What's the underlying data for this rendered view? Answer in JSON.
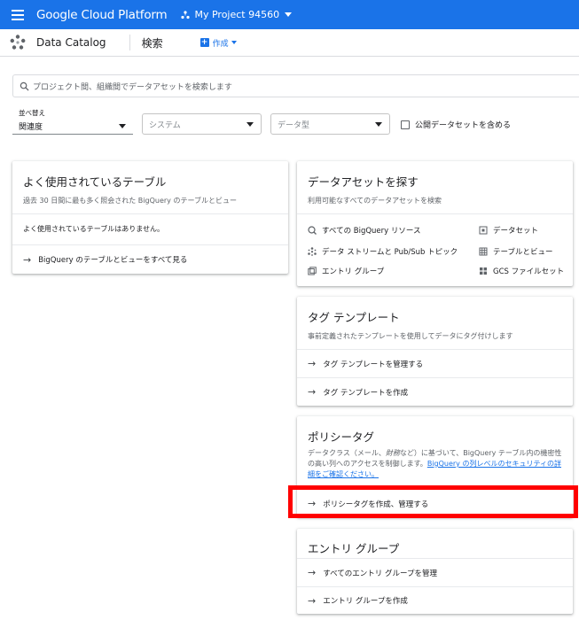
{
  "topbar": {
    "brand": "Google Cloud Platform",
    "project": "My Project 94560"
  },
  "subbar": {
    "app_title": "Data Catalog",
    "page_title": "検索",
    "create_label": "作成"
  },
  "search": {
    "placeholder": "プロジェクト間、組織間でデータアセットを検索します"
  },
  "filters": {
    "sort_label": "並べ替え",
    "sort_value": "関連度",
    "system_placeholder": "システム",
    "datatype_placeholder": "データ型",
    "public_label": "公開データセットを含める"
  },
  "frequent": {
    "title": "よく使用されているテーブル",
    "desc": "過去 30 日間に最も多く照会された BigQuery のテーブルとビュー",
    "empty": "よく使用されているテーブルはありません。",
    "link": "BigQuery のテーブルとビューをすべて見る"
  },
  "explore": {
    "title": "データアセットを探す",
    "desc": "利用可能なすべてのデータアセットを検索",
    "items": [
      {
        "label": "すべての BigQuery リソース",
        "icon": "bigquery-icon"
      },
      {
        "label": "データ ストリームと Pub/Sub トピック",
        "icon": "pubsub-icon"
      },
      {
        "label": "エントリ グループ",
        "icon": "entry-group-icon"
      },
      {
        "label": "データセット",
        "icon": "dataset-icon"
      },
      {
        "label": "テーブルとビュー",
        "icon": "table-icon"
      },
      {
        "label": "GCS ファイルセット",
        "icon": "fileset-icon"
      }
    ]
  },
  "tag_templates": {
    "title": "タグ テンプレート",
    "desc": "事前定義されたテンプレートを使用してデータにタグ付けします",
    "links": [
      "タグ テンプレートを管理する",
      "タグ テンプレートを作成"
    ]
  },
  "policy_tags": {
    "title": "ポリシータグ",
    "desc_1": "データクラス（メール、",
    "desc_em": "財務",
    "desc_2": "など）に基づいて、BigQuery テーブル内の機密性の高い列へのアクセスを制御します。",
    "desc_link": "BigQuery の列レベルのセキュリティの詳細をご確認ください。",
    "link": "ポリシータグを作成、管理する"
  },
  "entry_groups": {
    "title": "エントリ グループ",
    "links": [
      "すべてのエントリ グループを管理",
      "エントリ グループを作成"
    ]
  },
  "colors": {
    "topbar": "#1a73e8",
    "highlight": "#ff0000"
  }
}
